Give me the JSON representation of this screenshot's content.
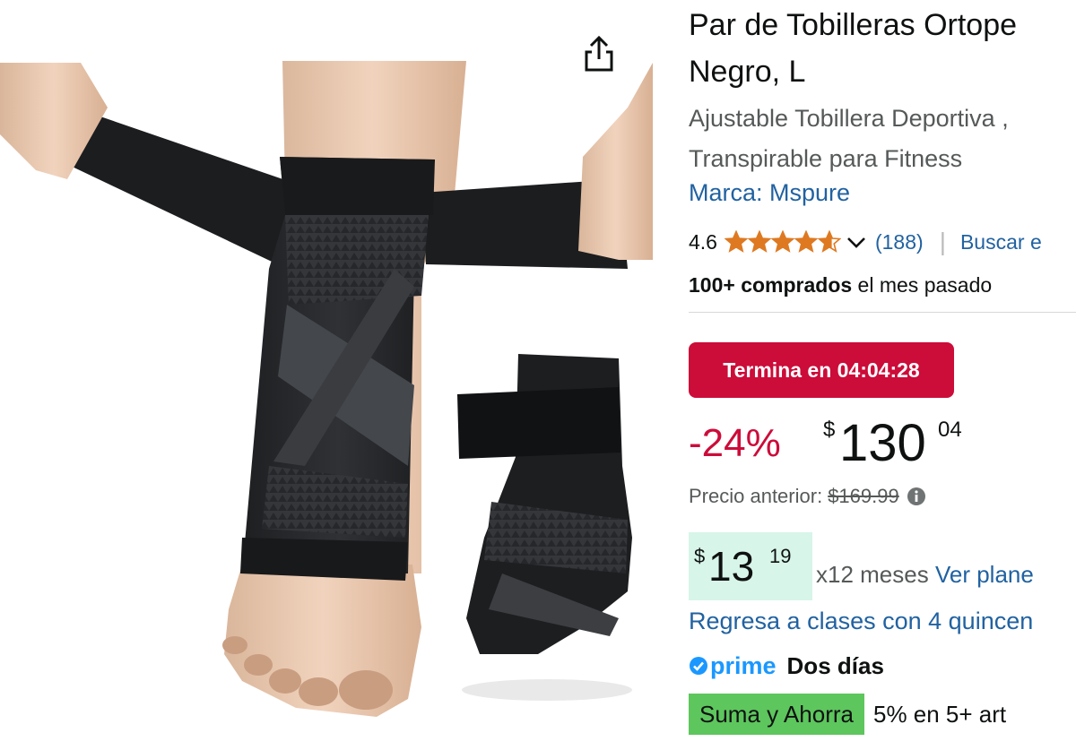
{
  "colors": {
    "link": "#2162a1",
    "deal_red": "#cc0c39",
    "star": "#de7921",
    "prime_blue": "#1a98ff",
    "install_bg": "#d7f5e9",
    "save_green": "#5dc65d",
    "muted": "#565959"
  },
  "media": {
    "product_image_icon": "ankle-brace-photo",
    "share_icon": "share-icon"
  },
  "product": {
    "title_lines": [
      "Par de Tobilleras Ortope",
      "Negro, L"
    ],
    "subtitle_lines": [
      "Ajustable Tobillera Deportiva ,",
      "Transpirable para Fitness"
    ],
    "brand": "Marca: Mspure"
  },
  "rating": {
    "value": "4.6",
    "stars_out_of_5": 4.6,
    "count": "(188)",
    "separator": "|",
    "search_link": "Buscar e"
  },
  "bought": {
    "bold": "100+ comprados",
    "rest": " el mes pasado"
  },
  "deal": {
    "badge": "Termina en 04:04:28"
  },
  "price": {
    "discount": "-24%",
    "symbol": "$",
    "whole": "130",
    "fraction": "04",
    "previous_label": "Precio anterior:",
    "previous_value": "$169.99"
  },
  "installments": {
    "symbol": "$",
    "whole": "13",
    "fraction": "19",
    "months": "x12 meses ",
    "plans_link": "Ver plane"
  },
  "promo": {
    "link": "Regresa a clases con 4 quincen"
  },
  "prime": {
    "word": "prime",
    "delivery": "Dos días"
  },
  "save": {
    "badge": "Suma y Ahorra",
    "text": "5% en 5+ art"
  }
}
